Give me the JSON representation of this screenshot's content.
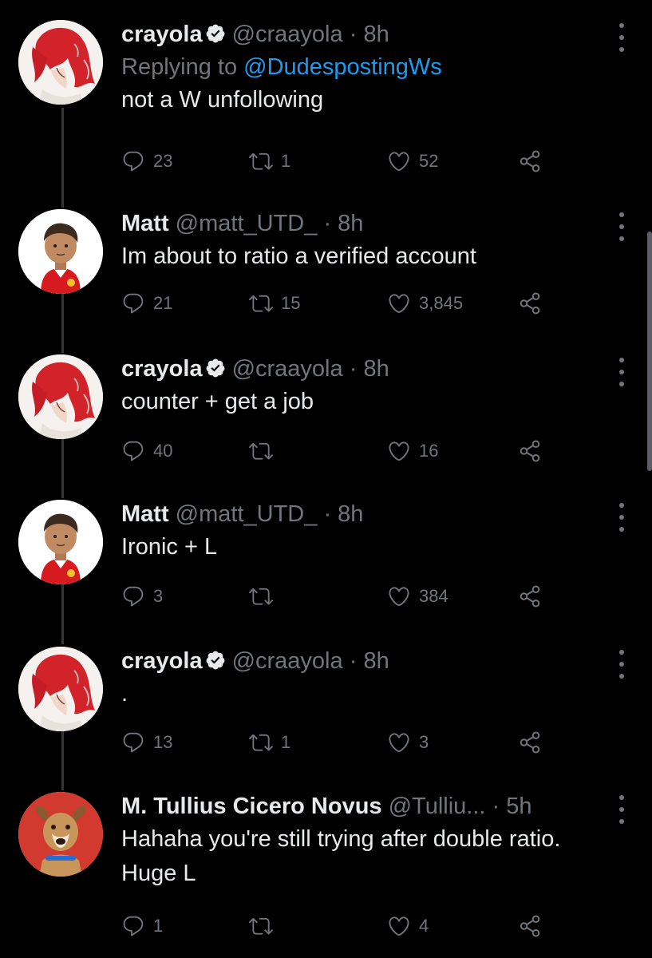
{
  "colors": {
    "background": "#000000",
    "text": "#e7e9ea",
    "muted": "#71767b",
    "link": "#1d9bf0",
    "verified": "#e7e9ea"
  },
  "tweets": [
    {
      "avatar": "red-haired-anime-avatar",
      "name": "crayola",
      "verified": true,
      "handle": "@craayola",
      "dot": "·",
      "time": "8h",
      "replying_prefix": "Replying to",
      "replying_to": "@DudespostingWs",
      "text": "not a W unfollowing",
      "replies": "23",
      "retweets": "1",
      "likes": "52"
    },
    {
      "avatar": "man-utd-player-avatar",
      "name": "Matt",
      "verified": false,
      "handle": "@matt_UTD_",
      "dot": "·",
      "time": "8h",
      "text": "Im about to ratio a verified account",
      "replies": "21",
      "retweets": "15",
      "likes": "3,845"
    },
    {
      "avatar": "red-haired-anime-avatar",
      "name": "crayola",
      "verified": true,
      "handle": "@craayola",
      "dot": "·",
      "time": "8h",
      "text": "counter + get a job",
      "replies": "40",
      "retweets": "",
      "likes": "16"
    },
    {
      "avatar": "man-utd-player-avatar",
      "name": "Matt",
      "verified": false,
      "handle": "@matt_UTD_",
      "dot": "·",
      "time": "8h",
      "text": "Ironic + L",
      "replies": "3",
      "retweets": "",
      "likes": "384"
    },
    {
      "avatar": "red-haired-anime-avatar",
      "name": "crayola",
      "verified": true,
      "handle": "@craayola",
      "dot": "·",
      "time": "8h",
      "text": ".",
      "replies": "13",
      "retweets": "1",
      "likes": "3"
    },
    {
      "avatar": "dog-avatar",
      "name": "M. Tullius Cicero Novus",
      "verified": false,
      "handle": "@Tulliu...",
      "dot": "·",
      "time": "5h",
      "text": "Hahaha you're still trying after double ratio. Huge L",
      "replies": "1",
      "retweets": "",
      "likes": "4"
    }
  ]
}
